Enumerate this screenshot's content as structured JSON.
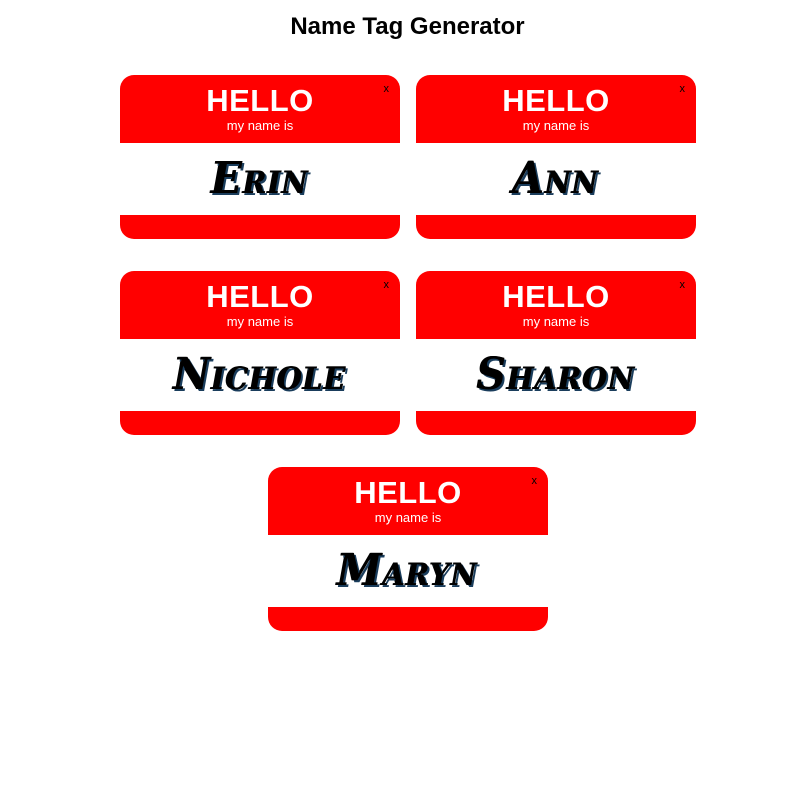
{
  "app": {
    "title": "Name Tag Generator"
  },
  "tag_template": {
    "hello": "HELLO",
    "subtitle": "my name is",
    "close_label": "x"
  },
  "tags": [
    {
      "name": "Erin"
    },
    {
      "name": "Ann"
    },
    {
      "name": "Nichole"
    },
    {
      "name": "Sharon"
    },
    {
      "name": "Maryn"
    }
  ],
  "colors": {
    "tag_red": "#ff0000",
    "tag_body": "#ffffff",
    "text": "#000000"
  }
}
